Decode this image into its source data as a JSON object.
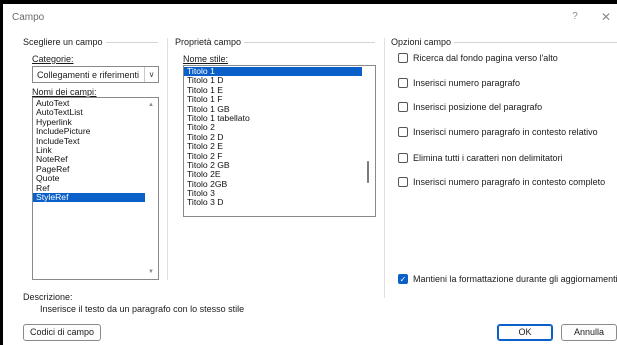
{
  "window": {
    "title": "Campo",
    "help_label": "?",
    "close_label": "✕"
  },
  "left_panel": {
    "group_title": "Scegliere un campo",
    "categories_label": "Categorie:",
    "categories_value": "Collegamenti e riferimenti",
    "field_names_label": "Nomi dei campi:",
    "field_names": [
      "AutoText",
      "AutoTextList",
      "Hyperlink",
      "IncludePicture",
      "IncludeText",
      "Link",
      "NoteRef",
      "PageRef",
      "Quote",
      "Ref",
      "StyleRef"
    ],
    "selected_field": "StyleRef"
  },
  "middle_panel": {
    "group_title": "Proprietà campo",
    "style_name_label": "Nome stile:",
    "styles": [
      "Titolo 1",
      "Titolo 1 D",
      "Titolo 1 E",
      "Titolo 1 F",
      "Titolo 1 GB",
      "Titolo 1 tabellato",
      "Titolo 2",
      "Titolo 2 D",
      "Titolo 2 E",
      "Titolo 2 F",
      "Titolo 2 GB",
      "Titolo 2E",
      "Titolo 2GB",
      "Titolo 3",
      "Titolo 3 D"
    ],
    "selected_style": "Titolo 1"
  },
  "right_panel": {
    "group_title": "Opzioni campo",
    "options": [
      {
        "label": "Ricerca dal fondo pagina verso l'alto",
        "checked": false
      },
      {
        "label": "Inserisci numero paragrafo",
        "checked": false
      },
      {
        "label": "Inserisci posizione del paragrafo",
        "checked": false
      },
      {
        "label": "Inserisci numero paragrafo in contesto relativo",
        "checked": false
      },
      {
        "label": "Elimina tutti i caratteri non delimitatori",
        "checked": false
      },
      {
        "label": "Inserisci numero paragrafo in contesto completo",
        "checked": false
      }
    ],
    "preserve_formatting": {
      "label": "Mantieni la formattazione durante gli aggiornamenti",
      "checked": true
    }
  },
  "description": {
    "label": "Descrizione:",
    "text": "Inserisce il testo da un paragrafo con lo stesso stile"
  },
  "footer": {
    "field_codes_button": "Codici di campo",
    "ok_button": "OK",
    "cancel_button": "Annulla"
  },
  "colors": {
    "accent": "#0a5fc8",
    "title_text": "#6b6b6b"
  },
  "icons": {
    "combo_arrow": "chevron-down-icon",
    "checkmark": "checkmark-icon"
  }
}
